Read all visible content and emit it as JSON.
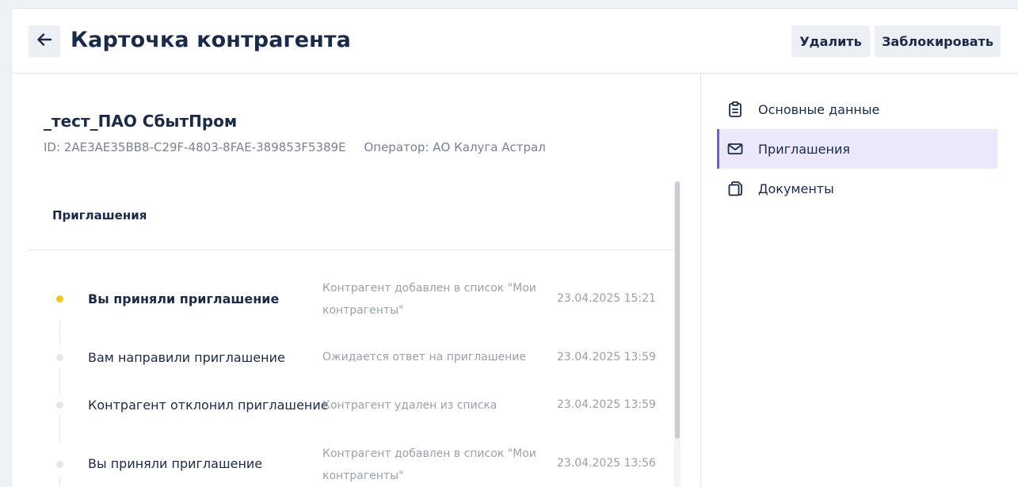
{
  "header": {
    "title": "Карточка контрагента",
    "back_icon": "arrow-left-icon",
    "delete_label": "Удалить",
    "block_label": "Заблокировать"
  },
  "contractor": {
    "name": "_тест_ПАО СбытПром",
    "id_text": "ID: 2AE3AE35BB8-C29F-4803-8FAE-389853F5389E",
    "operator_text": "Оператор: АО Калуга Астрал"
  },
  "nav": {
    "items": [
      {
        "label": "Основные данные",
        "icon": "clipboard-icon",
        "active": false
      },
      {
        "label": "Приглашения",
        "icon": "envelope-icon",
        "active": true
      },
      {
        "label": "Документы",
        "icon": "documents-icon",
        "active": false
      }
    ]
  },
  "invitations": {
    "section_title": "Приглашения",
    "events": [
      {
        "title": "Вы приняли приглашение",
        "desc": "Контрагент добавлен в список \"Мои контрагенты\"",
        "date": "23.04.2025 15:21",
        "status": "current"
      },
      {
        "title": "Вам направили приглашение",
        "desc": "Ожидается ответ на приглашение",
        "date": "23.04.2025 13:59",
        "status": "past"
      },
      {
        "title": "Контрагент отклонил приглашение",
        "desc": "Контрагент удален из списка",
        "date": "23.04.2025 13:59",
        "status": "past"
      },
      {
        "title": "Вы приняли приглашение",
        "desc": "Контрагент добавлен в список \"Мои контрагенты\"",
        "date": "23.04.2025 13:56",
        "status": "past"
      }
    ]
  },
  "colors": {
    "accent": "#6c5ce7",
    "active_nav_bg": "#ebe8fb",
    "current_dot": "#f5c518",
    "title_text": "#1a2a48"
  }
}
